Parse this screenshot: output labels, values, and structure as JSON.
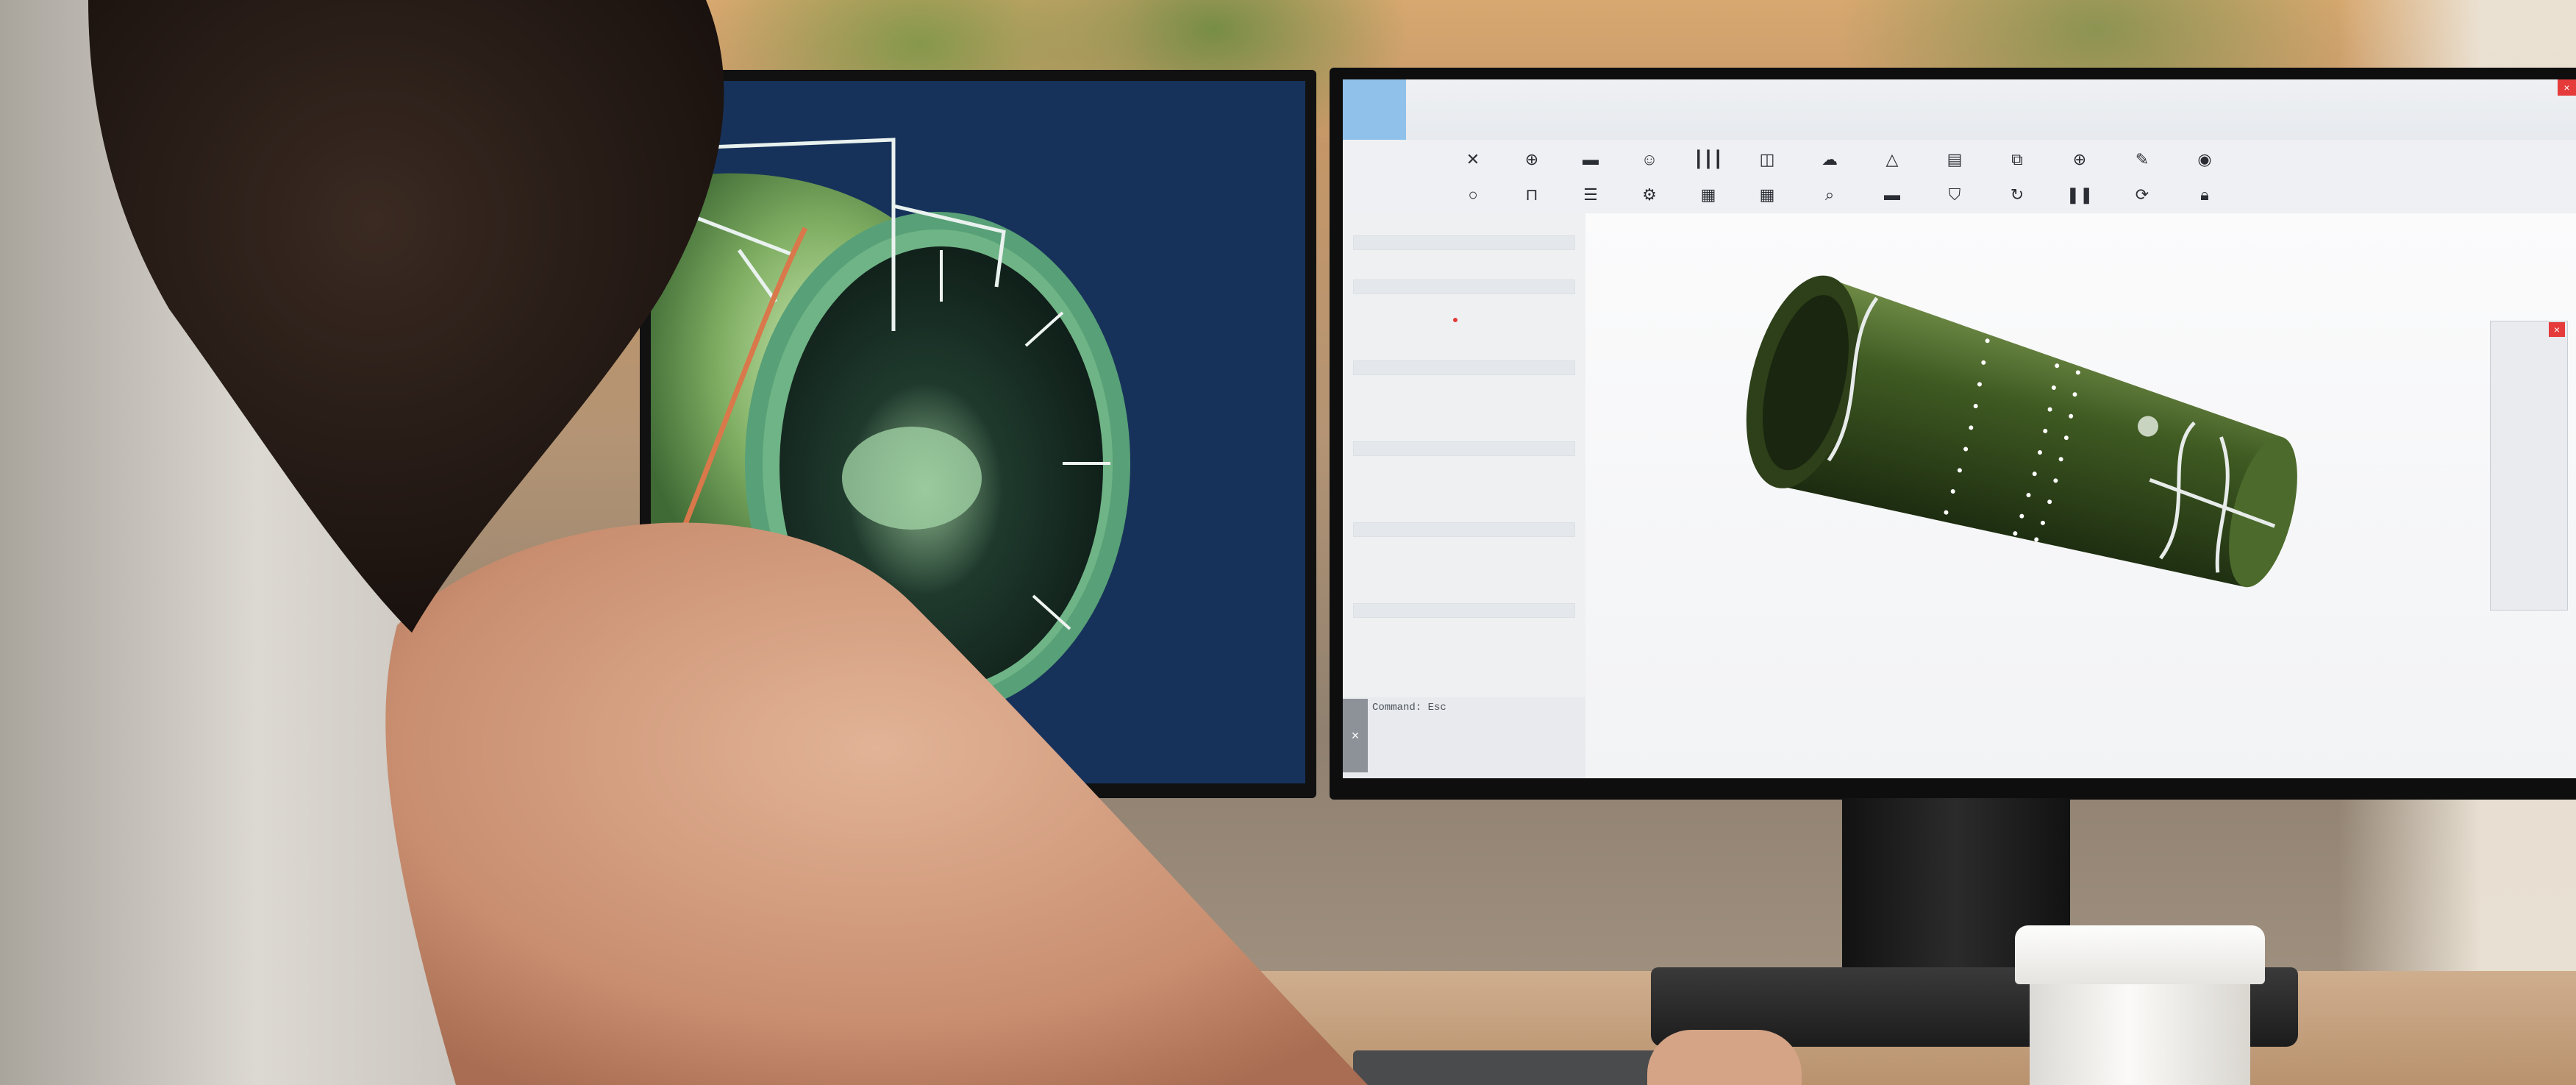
{
  "scene": {
    "description_free": true
  },
  "cad_app": {
    "command_line": {
      "label": "Command: Esc",
      "close_icon": "×"
    },
    "window_close_icon": "×",
    "floating_panel_close_icon": "×",
    "toolbar_row_1_icons": [
      "mirror-icon",
      "move-icon",
      "align-icon",
      "smiley-icon",
      "bars-icon",
      "frame-icon",
      "cloud-icon",
      "triangle-icon",
      "table-icon",
      "resize-icon",
      "circle-plus-icon",
      "pen-icon",
      "target-icon"
    ],
    "toolbar_row_2_icons": [
      "circle-icon",
      "arch-icon",
      "lines-icon",
      "gear-icon",
      "doc-icon",
      "grid-icon",
      "search-icon",
      "layer-icon",
      "shield-icon",
      "refresh-icon",
      "pause-icon",
      "rotate-icon",
      "lock-icon"
    ],
    "colors": {
      "accent": "#8fc1ea",
      "model_green": "#3d5a1f",
      "close_red": "#e53b3b"
    }
  }
}
